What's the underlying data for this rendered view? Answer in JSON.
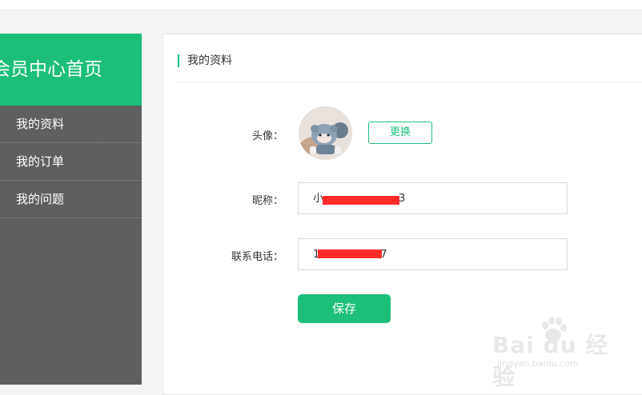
{
  "sidebar": {
    "title": "会员中心首页",
    "items": [
      {
        "label": "我的资料"
      },
      {
        "label": "我的订单"
      },
      {
        "label": "我的问题"
      }
    ]
  },
  "panel": {
    "title": "我的资料",
    "avatar_label": "头像：",
    "change_label": "更换",
    "nickname_label": "昵称：",
    "nickname_prefix": "小",
    "nickname_suffix": "3",
    "phone_label": "联系电话：",
    "phone_prefix": "1",
    "phone_suffix": "7",
    "save_label": "保存"
  },
  "watermark": {
    "brand": "Bai du 经验",
    "url": "jingyan.baidu.com"
  },
  "colors": {
    "accent": "#1cbf7a",
    "sidebar_bg": "#5f5f5f",
    "redaction": "#ff2a2a"
  }
}
